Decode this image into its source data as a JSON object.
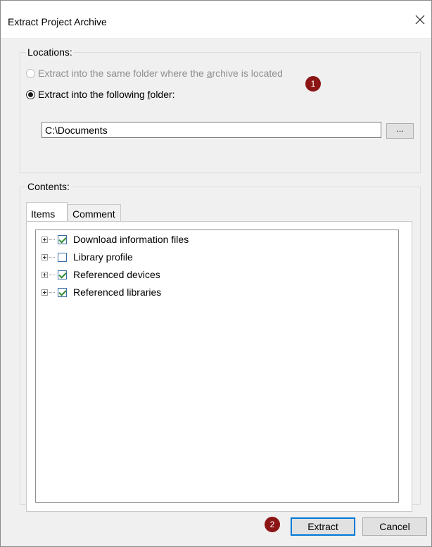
{
  "window": {
    "title": "Extract Project Archive"
  },
  "locations": {
    "label": "Locations:",
    "option_same_folder": {
      "before": "Extract into the same folder where the ",
      "accel": "a",
      "after": "rchive is located",
      "enabled": false,
      "selected": false
    },
    "option_following": {
      "before": "Extract into the following ",
      "accel": "f",
      "after": "older:",
      "enabled": true,
      "selected": true
    },
    "folder_value": "C:\\Documents",
    "browse_label": "..."
  },
  "contents": {
    "label": "Contents:",
    "tabs": [
      {
        "label": "Items",
        "active": true
      },
      {
        "label": "Comment",
        "active": false
      }
    ],
    "items": [
      {
        "label": "Download information files",
        "checked": true
      },
      {
        "label": "Library profile",
        "checked": false
      },
      {
        "label": "Referenced devices",
        "checked": true
      },
      {
        "label": "Referenced libraries",
        "checked": true
      }
    ]
  },
  "badges": [
    "1",
    "2"
  ],
  "buttons": {
    "extract": "Extract",
    "cancel": "Cancel"
  },
  "colors": {
    "badge": "#8b1515",
    "check": "#2e8b2e",
    "accent": "#0078d7"
  }
}
